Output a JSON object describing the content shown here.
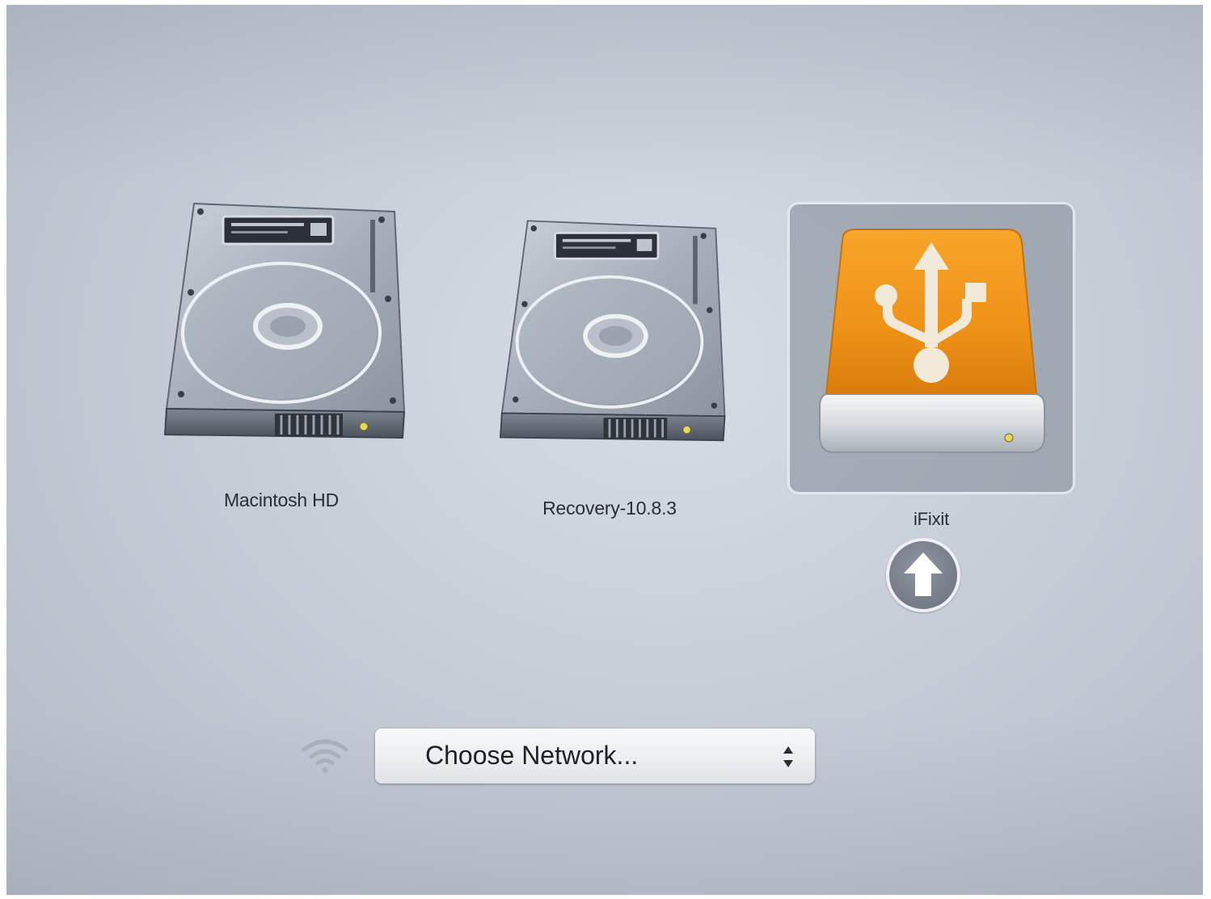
{
  "startup_manager": {
    "disks": [
      {
        "label": "Macintosh HD",
        "icon": "internal-hard-drive-icon",
        "selected": false
      },
      {
        "label": "Recovery-10.8.3",
        "icon": "internal-hard-drive-icon",
        "selected": false
      },
      {
        "label": "iFixit",
        "icon": "usb-drive-icon",
        "selected": true
      }
    ],
    "boot_button_icon": "up-arrow-icon",
    "network": {
      "wifi_icon": "wifi-icon",
      "popup_label": "Choose Network..."
    },
    "colors": {
      "usb_orange": "#f0961c",
      "selection_frame": "#808894"
    }
  }
}
